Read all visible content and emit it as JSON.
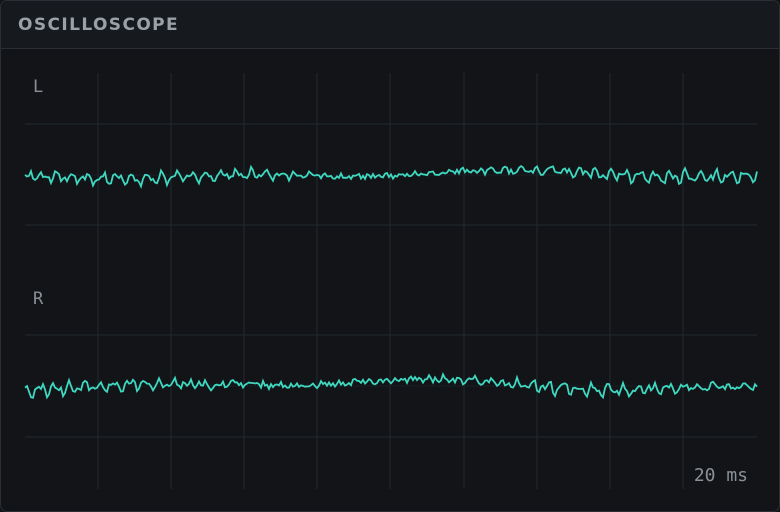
{
  "panel": {
    "title": "OSCILLOSCOPE",
    "time_scale": "20 ms"
  },
  "channels": [
    {
      "name": "L",
      "trace_color": "#3fd8c0",
      "seed": 7
    },
    {
      "name": "R",
      "trace_color": "#3fd8c0",
      "seed": 23
    }
  ],
  "colors": {
    "background": "#121417",
    "grid": "#232a30",
    "label": "#8a9098"
  }
}
